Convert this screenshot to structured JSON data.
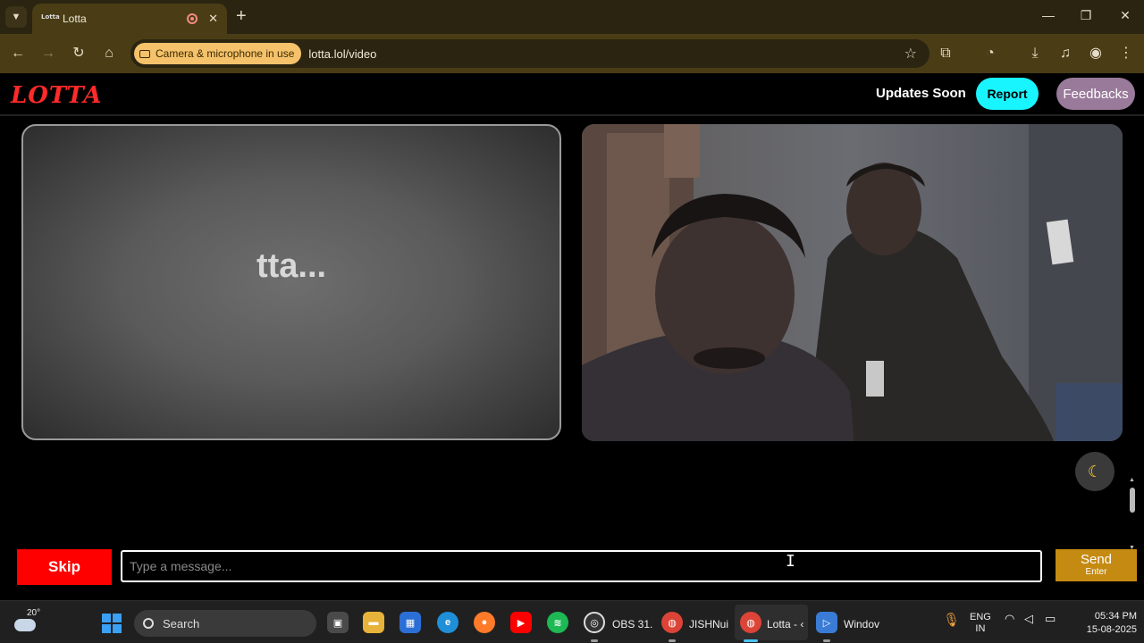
{
  "browser": {
    "tab": {
      "title": "Lotta",
      "favicon_text": "Lotta"
    },
    "permission_chip": "Camera & microphone in use",
    "url": "lotta.lol/video"
  },
  "site": {
    "logo": "LOTTA",
    "updates_text": "Updates Soon",
    "report_label": "Report",
    "feedback_label": "Feedbacks",
    "loading_text": "tta...",
    "theme_icon": "moon-icon",
    "skip_label": "Skip",
    "message_placeholder": "Type a message...",
    "message_value": "",
    "send_label": "Send",
    "send_hint": "Enter"
  },
  "taskbar": {
    "weather_temp": "20°",
    "search_label": "Search",
    "apps": [
      {
        "name": "obs",
        "label": "OBS 31."
      },
      {
        "name": "chrome-1",
        "label": "JISHNui"
      },
      {
        "name": "chrome-2",
        "label": "Lotta - ‹"
      },
      {
        "name": "windows-media",
        "label": "Windov"
      }
    ],
    "lang_top": "ENG",
    "lang_bottom": "IN",
    "time": "05:34 PM",
    "date": "15-08-2025"
  },
  "colors": {
    "logo": "#ff2a2a",
    "report": "#19f5ff",
    "feedback": "#9a7a9a",
    "skip": "#ff0000",
    "send": "#c58a12",
    "chrome_frame": "#4a3d16"
  }
}
